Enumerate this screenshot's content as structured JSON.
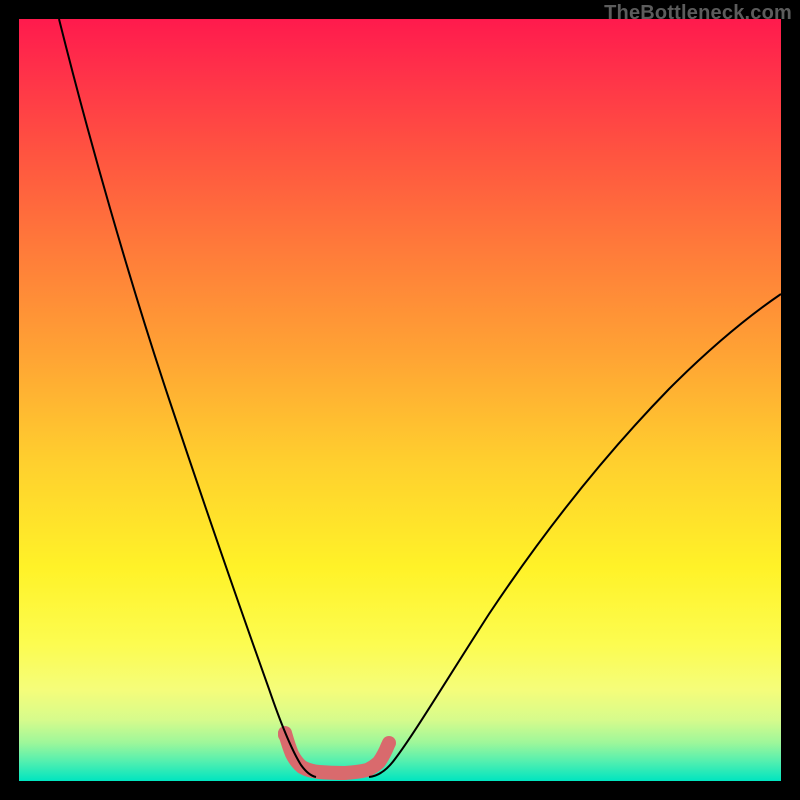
{
  "watermark": "TheBottleneck.com",
  "chart_data": {
    "type": "line",
    "title": "",
    "xlabel": "",
    "ylabel": "",
    "xlim": [
      0,
      100
    ],
    "ylim": [
      0,
      100
    ],
    "grid": false,
    "legend": false,
    "series": [
      {
        "name": "left-curve",
        "color": "#000000",
        "x": [
          5,
          8,
          12,
          16,
          20,
          24,
          28,
          31,
          33,
          35,
          36.5,
          37.5
        ],
        "y": [
          100,
          87,
          72,
          58,
          45,
          33,
          22,
          13,
          8,
          4.5,
          2.5,
          1.5
        ]
      },
      {
        "name": "right-curve",
        "color": "#000000",
        "x": [
          47,
          48.5,
          51,
          55,
          60,
          66,
          73,
          80,
          88,
          96,
          100
        ],
        "y": [
          1.5,
          2.5,
          5,
          10,
          17,
          25,
          34,
          43,
          52,
          60,
          64
        ]
      },
      {
        "name": "trough-highlight",
        "color": "#d96a6d",
        "x": [
          35,
          35.5,
          36,
          36.5,
          37.2,
          38,
          39,
          40,
          41.5,
          43,
          44.5,
          45.7,
          46.5,
          47.3,
          48,
          48.5
        ],
        "y": [
          6.2,
          4.6,
          3.3,
          2.4,
          1.7,
          1.3,
          1.1,
          1.0,
          1.0,
          1.0,
          1.1,
          1.4,
          1.8,
          2.3,
          3.2,
          4.4
        ]
      }
    ],
    "background_gradient_stops": [
      {
        "pos": 0.0,
        "color": "#ff1a4d"
      },
      {
        "pos": 0.3,
        "color": "#ff7a3a"
      },
      {
        "pos": 0.58,
        "color": "#ffcf2e"
      },
      {
        "pos": 0.82,
        "color": "#fcfc50"
      },
      {
        "pos": 1.0,
        "color": "#00e5c0"
      }
    ]
  }
}
